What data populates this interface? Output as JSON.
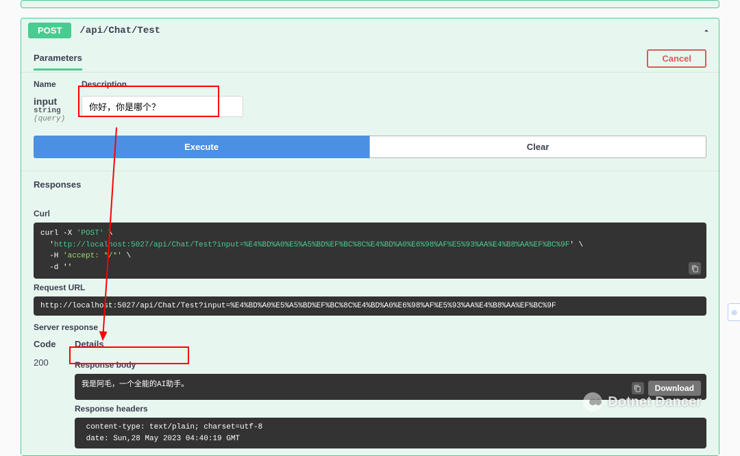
{
  "op": {
    "method": "POST",
    "path": "/api/Chat/Test"
  },
  "tabs": {
    "parameters": "Parameters",
    "cancel": "Cancel"
  },
  "table": {
    "name_header": "Name",
    "desc_header": "Description"
  },
  "param": {
    "name": "input",
    "type": "string",
    "in": "(query)",
    "value": "你好，你是哪个？"
  },
  "buttons": {
    "execute": "Execute",
    "clear": "Clear",
    "download": "Download"
  },
  "sections": {
    "responses": "Responses",
    "curl": "Curl",
    "request_url": "Request URL",
    "server_response": "Server response",
    "code": "Code",
    "details": "Details",
    "response_body": "Response body",
    "response_headers": "Response headers"
  },
  "curl": {
    "line1_a": "curl -X ",
    "line1_b": "'POST'",
    "line1_c": " \\",
    "line2_a": "  '",
    "line2_b": "http://localhost:5027/api/Chat/Test?input=%E4%BD%A0%E5%A5%BD%EF%BC%8C%E4%BD%A0%E6%98%AF%E5%93%AA%E4%B8%AA%EF%BC%9F",
    "line2_c": "' \\",
    "line3_a": "  -H ",
    "line3_b": "'accept: */*'",
    "line3_c": " \\",
    "line4": "  -d ''"
  },
  "request_url": "http://localhost:5027/api/Chat/Test?input=%E4%BD%A0%E5%A5%BD%EF%BC%8C%E4%BD%A0%E6%98%AF%E5%93%AA%E4%B8%AA%EF%BC%9F",
  "response": {
    "status": "200",
    "body": "我是阿毛，一个全能的AI助手。",
    "headers_line1": " content-type: text/plain; charset=utf-8 ",
    "headers_line2": " date: Sun,28 May 2023 04:40:19 GMT "
  },
  "watermark": "Dotnet Dancer"
}
